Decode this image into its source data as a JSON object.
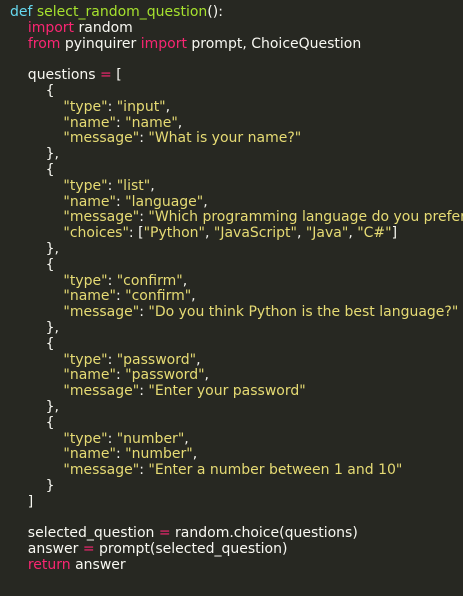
{
  "colors": {
    "background": "#272822",
    "text": "#f8f8f2",
    "keyword": "#f92672",
    "def_keyword": "#66d9ef",
    "function_name": "#a6e22e",
    "string": "#e6db74"
  },
  "code": {
    "lines": [
      [
        [
          "def",
          "def"
        ],
        [
          "fn",
          " select_random_question"
        ],
        [
          "punc",
          "():"
        ]
      ],
      [
        [
          "punc",
          "    "
        ],
        [
          "kw",
          "import"
        ],
        [
          "punc",
          " random"
        ]
      ],
      [
        [
          "punc",
          "    "
        ],
        [
          "kw",
          "from"
        ],
        [
          "punc",
          " pyinquirer "
        ],
        [
          "kw",
          "import"
        ],
        [
          "punc",
          " prompt, ChoiceQuestion"
        ]
      ],
      [],
      [
        [
          "punc",
          "    questions "
        ],
        [
          "op",
          "="
        ],
        [
          "punc",
          " ["
        ]
      ],
      [
        [
          "punc",
          "        {"
        ]
      ],
      [
        [
          "punc",
          "            "
        ],
        [
          "str",
          "\"type\""
        ],
        [
          "punc",
          ": "
        ],
        [
          "str",
          "\"input\""
        ],
        [
          "punc",
          ","
        ]
      ],
      [
        [
          "punc",
          "            "
        ],
        [
          "str",
          "\"name\""
        ],
        [
          "punc",
          ": "
        ],
        [
          "str",
          "\"name\""
        ],
        [
          "punc",
          ","
        ]
      ],
      [
        [
          "punc",
          "            "
        ],
        [
          "str",
          "\"message\""
        ],
        [
          "punc",
          ": "
        ],
        [
          "str",
          "\"What is your name?\""
        ]
      ],
      [
        [
          "punc",
          "        },"
        ]
      ],
      [
        [
          "punc",
          "        {"
        ]
      ],
      [
        [
          "punc",
          "            "
        ],
        [
          "str",
          "\"type\""
        ],
        [
          "punc",
          ": "
        ],
        [
          "str",
          "\"list\""
        ],
        [
          "punc",
          ","
        ]
      ],
      [
        [
          "punc",
          "            "
        ],
        [
          "str",
          "\"name\""
        ],
        [
          "punc",
          ": "
        ],
        [
          "str",
          "\"language\""
        ],
        [
          "punc",
          ","
        ]
      ],
      [
        [
          "punc",
          "            "
        ],
        [
          "str",
          "\"message\""
        ],
        [
          "punc",
          ": "
        ],
        [
          "str",
          "\"Which programming language do you prefer?\""
        ],
        [
          "punc",
          ","
        ]
      ],
      [
        [
          "punc",
          "            "
        ],
        [
          "str",
          "\"choices\""
        ],
        [
          "punc",
          ": ["
        ],
        [
          "str",
          "\"Python\""
        ],
        [
          "punc",
          ", "
        ],
        [
          "str",
          "\"JavaScript\""
        ],
        [
          "punc",
          ", "
        ],
        [
          "str",
          "\"Java\""
        ],
        [
          "punc",
          ", "
        ],
        [
          "str",
          "\"C#\""
        ],
        [
          "punc",
          "]"
        ]
      ],
      [
        [
          "punc",
          "        },"
        ]
      ],
      [
        [
          "punc",
          "        {"
        ]
      ],
      [
        [
          "punc",
          "            "
        ],
        [
          "str",
          "\"type\""
        ],
        [
          "punc",
          ": "
        ],
        [
          "str",
          "\"confirm\""
        ],
        [
          "punc",
          ","
        ]
      ],
      [
        [
          "punc",
          "            "
        ],
        [
          "str",
          "\"name\""
        ],
        [
          "punc",
          ": "
        ],
        [
          "str",
          "\"confirm\""
        ],
        [
          "punc",
          ","
        ]
      ],
      [
        [
          "punc",
          "            "
        ],
        [
          "str",
          "\"message\""
        ],
        [
          "punc",
          ": "
        ],
        [
          "str",
          "\"Do you think Python is the best language?\""
        ]
      ],
      [
        [
          "punc",
          "        },"
        ]
      ],
      [
        [
          "punc",
          "        {"
        ]
      ],
      [
        [
          "punc",
          "            "
        ],
        [
          "str",
          "\"type\""
        ],
        [
          "punc",
          ": "
        ],
        [
          "str",
          "\"password\""
        ],
        [
          "punc",
          ","
        ]
      ],
      [
        [
          "punc",
          "            "
        ],
        [
          "str",
          "\"name\""
        ],
        [
          "punc",
          ": "
        ],
        [
          "str",
          "\"password\""
        ],
        [
          "punc",
          ","
        ]
      ],
      [
        [
          "punc",
          "            "
        ],
        [
          "str",
          "\"message\""
        ],
        [
          "punc",
          ": "
        ],
        [
          "str",
          "\"Enter your password\""
        ]
      ],
      [
        [
          "punc",
          "        },"
        ]
      ],
      [
        [
          "punc",
          "        {"
        ]
      ],
      [
        [
          "punc",
          "            "
        ],
        [
          "str",
          "\"type\""
        ],
        [
          "punc",
          ": "
        ],
        [
          "str",
          "\"number\""
        ],
        [
          "punc",
          ","
        ]
      ],
      [
        [
          "punc",
          "            "
        ],
        [
          "str",
          "\"name\""
        ],
        [
          "punc",
          ": "
        ],
        [
          "str",
          "\"number\""
        ],
        [
          "punc",
          ","
        ]
      ],
      [
        [
          "punc",
          "            "
        ],
        [
          "str",
          "\"message\""
        ],
        [
          "punc",
          ": "
        ],
        [
          "str",
          "\"Enter a number between 1 and 10\""
        ]
      ],
      [
        [
          "punc",
          "        }"
        ]
      ],
      [
        [
          "punc",
          "    ]"
        ]
      ],
      [],
      [
        [
          "punc",
          "    selected_question "
        ],
        [
          "op",
          "="
        ],
        [
          "punc",
          " random.choice(questions)"
        ]
      ],
      [
        [
          "punc",
          "    answer "
        ],
        [
          "op",
          "="
        ],
        [
          "punc",
          " prompt(selected_question)"
        ]
      ],
      [
        [
          "punc",
          "    "
        ],
        [
          "kw",
          "return"
        ],
        [
          "punc",
          " answer"
        ]
      ]
    ]
  }
}
